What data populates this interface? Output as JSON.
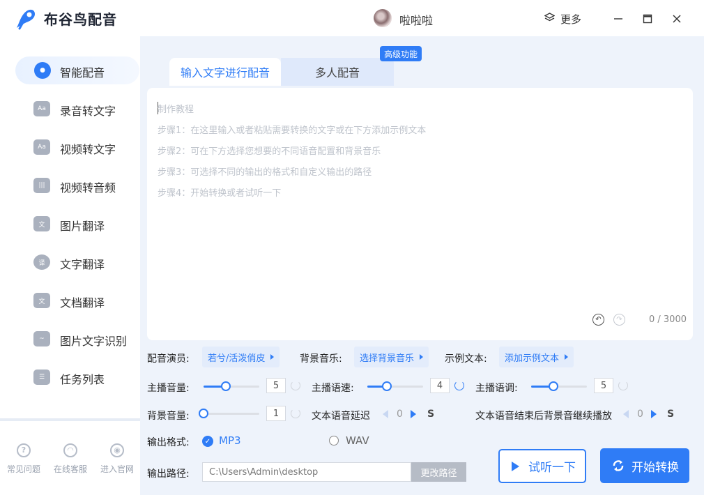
{
  "app": {
    "title": "布谷鸟配音",
    "username": "啦啦啦",
    "more_label": "更多"
  },
  "sidebar": {
    "items": [
      {
        "label": "智能配音",
        "icon": "mic-icon"
      },
      {
        "label": "录音转文字",
        "icon": "audio-text-icon"
      },
      {
        "label": "视频转文字",
        "icon": "video-text-icon"
      },
      {
        "label": "视频转音频",
        "icon": "video-audio-icon"
      },
      {
        "label": "图片翻译",
        "icon": "image-translate-icon"
      },
      {
        "label": "文字翻译",
        "icon": "text-translate-icon"
      },
      {
        "label": "文档翻译",
        "icon": "doc-translate-icon"
      },
      {
        "label": "图片文字识别",
        "icon": "ocr-icon"
      },
      {
        "label": "任务列表",
        "icon": "task-list-icon"
      }
    ],
    "footer": [
      {
        "label": "常见问题",
        "icon": "help-icon"
      },
      {
        "label": "在线客服",
        "icon": "support-icon"
      },
      {
        "label": "进入官网",
        "icon": "website-icon"
      }
    ]
  },
  "tabs": {
    "tab1": "输入文字进行配音",
    "tab2": "多人配音",
    "badge": "高级功能"
  },
  "editor": {
    "placeholder_lines": [
      "制作教程",
      "步骤1：在这里输入或者粘贴需要转换的文字或在下方添加示例文本",
      "步骤2：可在下方选择您想要的不同语音配置和背景音乐",
      "步骤3：可选择不同的输出的格式和自定义输出的路径",
      "步骤4：开始转换或者试听一下"
    ],
    "char_count": "0 / 3000"
  },
  "settings": {
    "voice_label": "配音演员:",
    "voice_value": "若兮/活泼俏皮",
    "bgm_label": "背景音乐:",
    "bgm_value": "选择背景音乐",
    "sample_label": "示例文本:",
    "sample_value": "添加示例文本",
    "main_volume_label": "主播音量:",
    "main_volume_value": "5",
    "main_volume_fraction": 0.4,
    "speed_label": "主播语速:",
    "speed_value": "4",
    "speed_fraction": 0.35,
    "pitch_label": "主播语调:",
    "pitch_value": "5",
    "pitch_fraction": 0.4,
    "bg_volume_label": "背景音量:",
    "bg_volume_value": "1",
    "bg_volume_fraction": 0.0,
    "delay_label": "文本语音延迟",
    "delay_value": "0",
    "delay_unit": "S",
    "bg_continue_label": "文本语音结束后背景音继续播放",
    "bg_continue_value": "0",
    "bg_continue_unit": "S",
    "format_label": "输出格式:",
    "format_mp3": "MP3",
    "format_wav": "WAV",
    "path_label": "输出路径:",
    "path_value": "C:\\Users\\Admin\\desktop",
    "path_button": "更改路径"
  },
  "actions": {
    "listen": "试听一下",
    "start": "开始转换"
  },
  "colors": {
    "accent": "#2f7cf6",
    "background": "#eef3fb"
  }
}
